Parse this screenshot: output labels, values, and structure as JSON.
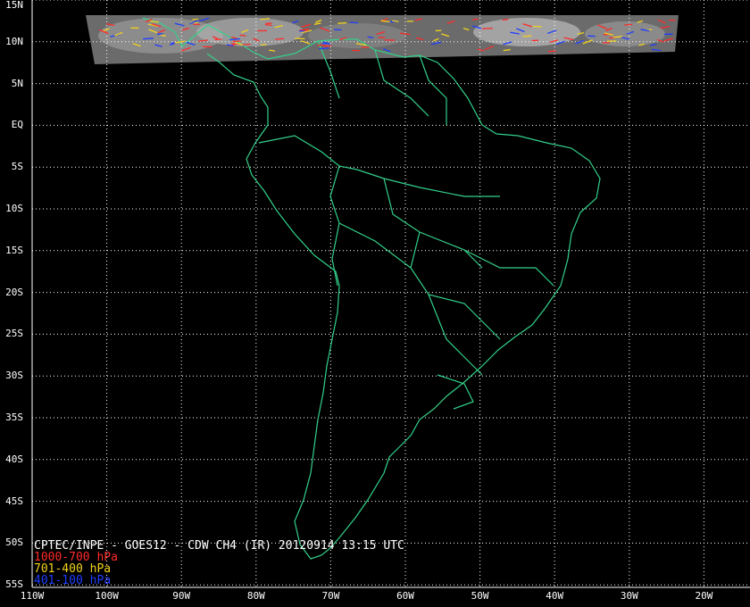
{
  "map": {
    "title": "CPTEC/INPE - GOES12 - CDW CH4 (IR) 20120914 13:15 UTC",
    "lat_labels": [
      "15N",
      "10N",
      "5N",
      "EQ",
      "5S",
      "10S",
      "15S",
      "20S",
      "25S",
      "30S",
      "35S",
      "40S",
      "45S",
      "50S",
      "55S"
    ],
    "lon_labels": [
      "110W",
      "100W",
      "90W",
      "80W",
      "70W",
      "60W",
      "50W",
      "40W",
      "30W",
      "20W"
    ],
    "legend": [
      {
        "label": "1000-700 hPa",
        "color": "#ff2a2a"
      },
      {
        "label": "701-400 hPa",
        "color": "#f2d21c"
      },
      {
        "label": "401-100 hPa",
        "color": "#1f3dff"
      }
    ],
    "colors": {
      "background": "#000000",
      "coastline": "#33d08a",
      "grid": "#ffffff",
      "cloud_swath": "#8c8c8c"
    }
  }
}
